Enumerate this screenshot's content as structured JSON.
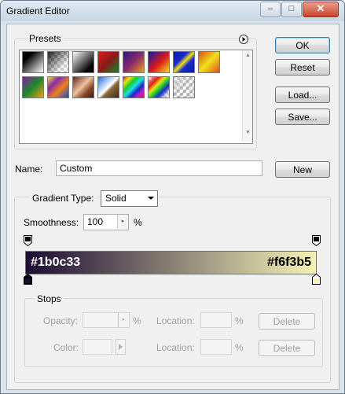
{
  "window": {
    "title": "Gradient Editor",
    "controls": [
      "–",
      "□",
      "✕"
    ]
  },
  "presets": {
    "label": "Presets",
    "menu_icon": "circle-arrow-right-icon",
    "swatches": [
      {
        "name": "black-white"
      },
      {
        "name": "transparent-checker"
      },
      {
        "name": "white-black"
      },
      {
        "name": "red-green"
      },
      {
        "name": "violet-orange"
      },
      {
        "name": "blue-red-yellow"
      },
      {
        "name": "blue-yellow-blue"
      },
      {
        "name": "orange-yellow-orange"
      },
      {
        "name": "violet-green-orange"
      },
      {
        "name": "yellow-violet-orange-blue"
      },
      {
        "name": "copper"
      },
      {
        "name": "chrome"
      },
      {
        "name": "spectrum"
      },
      {
        "name": "transparent-rainbow"
      },
      {
        "name": "transparent-stripes"
      }
    ]
  },
  "buttons": {
    "ok": "OK",
    "reset": "Reset",
    "load": "Load...",
    "save": "Save...",
    "new": "New"
  },
  "name_field": {
    "label": "Name:",
    "value": "Custom"
  },
  "gradient_type": {
    "label": "Gradient Type:",
    "value": "Solid"
  },
  "smoothness": {
    "label": "Smoothness:",
    "value": "100",
    "unit": "%"
  },
  "gradient": {
    "start_color": "#1b0c33",
    "end_color": "#f6f3b5",
    "left_label": "#1b0c33",
    "right_label": "#f6f3b5"
  },
  "stops": {
    "label": "Stops",
    "opacity_label": "Opacity:",
    "opacity_unit": "%",
    "color_label": "Color:",
    "location_label_1": "Location:",
    "location_unit_1": "%",
    "location_label_2": "Location:",
    "location_unit_2": "%",
    "delete_1": "Delete",
    "delete_2": "Delete"
  },
  "colors": {
    "accent": "#3c7fb1",
    "disabled_text": "#a0a0a0"
  }
}
